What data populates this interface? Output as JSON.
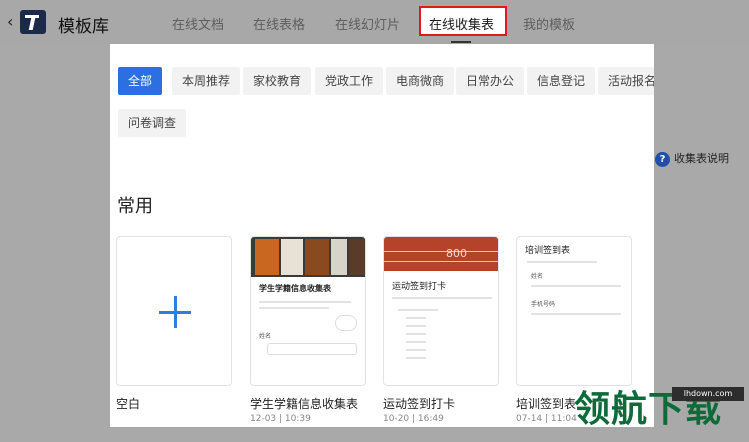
{
  "header": {
    "back": "‹",
    "title": "模板库",
    "tabs": [
      {
        "label": "在线文档"
      },
      {
        "label": "在线表格"
      },
      {
        "label": "在线幻灯片"
      },
      {
        "label": "在线收集表"
      },
      {
        "label": "我的模板"
      }
    ],
    "active_tab": "在线收集表"
  },
  "help": {
    "label": "收集表说明"
  },
  "categories": [
    "全部",
    "本周推荐",
    "家校教育",
    "党政工作",
    "电商微商",
    "日常办公",
    "信息登记",
    "活动报名",
    "问卷调查"
  ],
  "selected_category": "全部",
  "section_title": "常用",
  "templates": [
    {
      "name": "空白",
      "date": ""
    },
    {
      "name": "学生学籍信息收集表",
      "date": "12-03 | 10:39",
      "preview_title": "学生学籍信息收集表",
      "field": "姓名"
    },
    {
      "name": "运动签到打卡",
      "date": "10-20 | 16:49",
      "preview_title": "运动签到打卡",
      "banner_text": "800"
    },
    {
      "name": "培训签到表",
      "date": "07-14 | 11:04",
      "preview_title": "培训签到表",
      "fields": [
        "姓名",
        "手机号码"
      ]
    }
  ],
  "watermark": {
    "text": "领航下载",
    "site": "lhdown.com"
  },
  "colors": {
    "accent": "#2b6fe0",
    "highlight_border": "#e0191f"
  }
}
